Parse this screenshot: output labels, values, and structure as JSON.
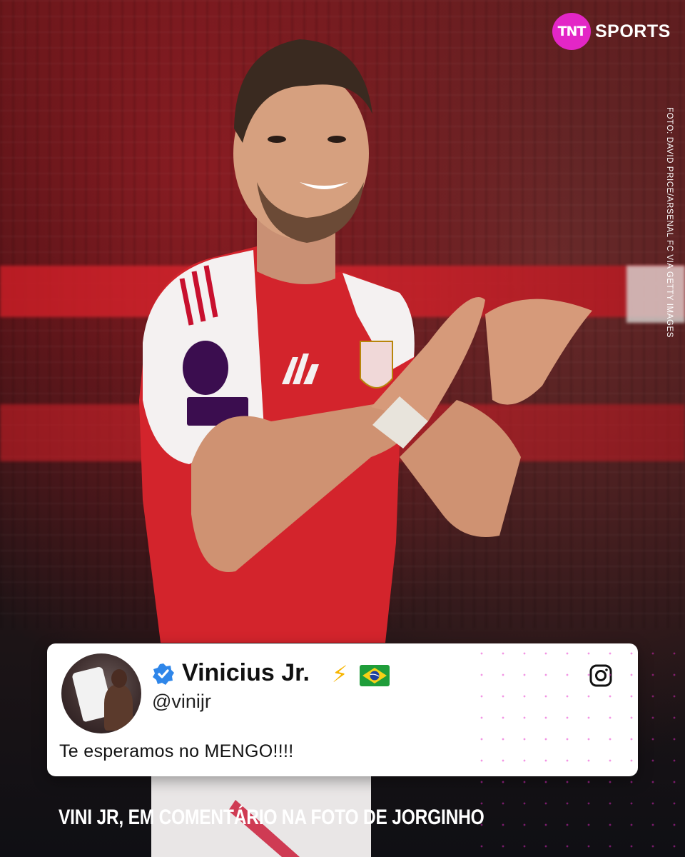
{
  "brand": {
    "logo_badge": "TNT",
    "logo_text": "SPORTS",
    "accent_color": "#e326c6"
  },
  "photo_credit": "FOTO: DAVID PRICE/ARSENAL FC VIA GETTY IMAGES",
  "post": {
    "name": "Vinicius Jr.",
    "emoji_bolt": "⚡",
    "flag": "brazil-flag",
    "handle": "@vinijr",
    "verified_icon": "verified-badge-icon",
    "platform_icon": "instagram-icon",
    "comment": "Te esperamos no MENGO!!!!"
  },
  "caption": "VINI JR, EM COMENTÁRIO NA FOTO DE JORGINHO"
}
